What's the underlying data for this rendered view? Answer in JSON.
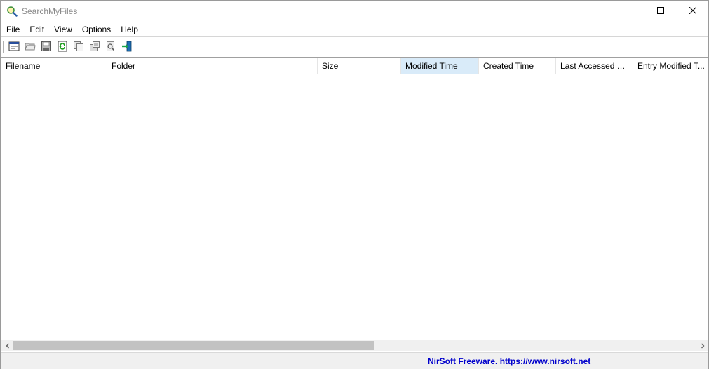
{
  "window": {
    "title": "SearchMyFiles",
    "icon": "magnifier-app-icon",
    "controls": {
      "minimize": "minimize-icon",
      "maximize": "maximize-icon",
      "close": "close-icon"
    }
  },
  "menu": {
    "items": [
      {
        "label": "File"
      },
      {
        "label": "Edit"
      },
      {
        "label": "View"
      },
      {
        "label": "Options"
      },
      {
        "label": "Help"
      }
    ]
  },
  "toolbar": {
    "buttons": [
      {
        "icon": "search-options-icon"
      },
      {
        "icon": "open-folder-icon"
      },
      {
        "icon": "save-icon"
      },
      {
        "icon": "refresh-icon"
      },
      {
        "icon": "copy-icon"
      },
      {
        "icon": "properties-icon"
      },
      {
        "icon": "find-icon"
      },
      {
        "icon": "exit-icon"
      }
    ]
  },
  "table": {
    "sorted_column": "Modified Time",
    "columns": [
      {
        "label": "Filename"
      },
      {
        "label": "Folder"
      },
      {
        "label": "Size"
      },
      {
        "label": "Modified Time"
      },
      {
        "label": "Created Time"
      },
      {
        "label": "Last Accessed Ti..."
      },
      {
        "label": "Entry Modified T..."
      }
    ],
    "rows": []
  },
  "statusbar": {
    "link_text": "NirSoft Freeware. https://www.nirsoft.net"
  },
  "colors": {
    "sorted_header_bg": "#d9ebf9",
    "link": "#0000cc"
  }
}
